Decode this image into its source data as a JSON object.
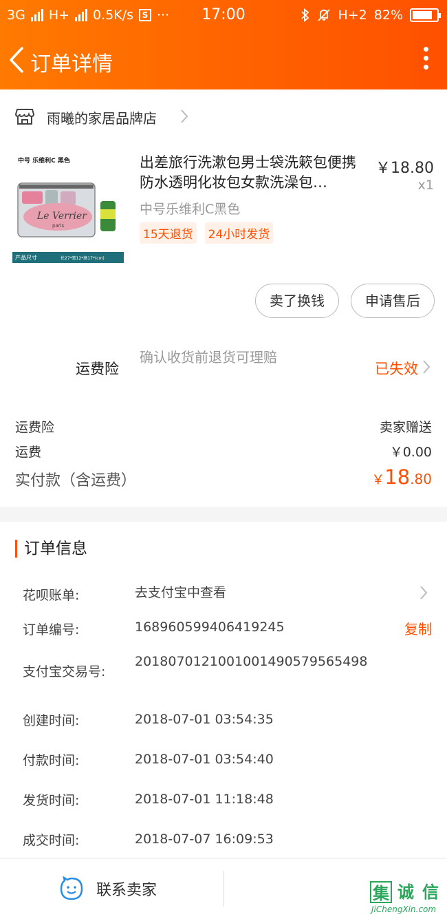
{
  "status_bar": {
    "network1": "3G",
    "network2": "H+",
    "speed": "0.5K/s",
    "s_icon": "S",
    "dots": "···",
    "time": "17:00",
    "h2": "H+2",
    "battery": "82%",
    "battery_level": 0.82
  },
  "nav": {
    "title": "订单详情"
  },
  "shop": {
    "name": "雨曦的家居品牌店"
  },
  "product": {
    "title": "出差旅行洗漱包男士袋洗簌包便携防水透明化妆包女款洗澡包…",
    "price": "￥18.80",
    "qty": "x1",
    "sku": "中号乐维利C黑色",
    "tags": [
      "15天退货",
      "24小时发货"
    ],
    "image": {
      "label_top": "中号 乐维利C 黑色",
      "brand_script": "Le Verrier",
      "brand_sub": "paris",
      "footer_label": "产品尺寸",
      "footer_dims": "长27*宽12*高17*(cm)"
    }
  },
  "buttons": {
    "sell": "卖了换钱",
    "after_sale": "申请售后"
  },
  "insurance": {
    "label": "运费险",
    "desc": "确认收货前退货可理赔",
    "status": "已失效"
  },
  "fees": [
    {
      "label": "运费险",
      "value": "卖家赠送"
    },
    {
      "label": "运费",
      "value": "￥0.00"
    }
  ],
  "payment": {
    "label": "实付款（含运费）",
    "currency": "￥",
    "integer": "18",
    "decimal": ".80"
  },
  "order_info": {
    "title": "订单信息",
    "rows": [
      {
        "label": "花呗账单:",
        "value": "去支付宝中查看"
      },
      {
        "label": "订单编号:",
        "value": "168960599406419245",
        "action": "复制"
      },
      {
        "label": "支付宝交易号:",
        "value": "2018070121001001490579565498"
      },
      {
        "label": "创建时间:",
        "value": "2018-07-01 03:54:35"
      },
      {
        "label": "付款时间:",
        "value": "2018-07-01 03:54:40"
      },
      {
        "label": "发货时间:",
        "value": "2018-07-01 11:18:48"
      },
      {
        "label": "成交时间:",
        "value": "2018-07-07 16:09:53"
      }
    ]
  },
  "footer": {
    "contact": "联系卖家"
  },
  "watermark": {
    "chars": [
      "集",
      "诚",
      "信"
    ],
    "url": "JiChengXin.com"
  },
  "colors": {
    "accent": "#ff5000",
    "header_start": "#ff7a00",
    "header_end": "#ff5000"
  }
}
